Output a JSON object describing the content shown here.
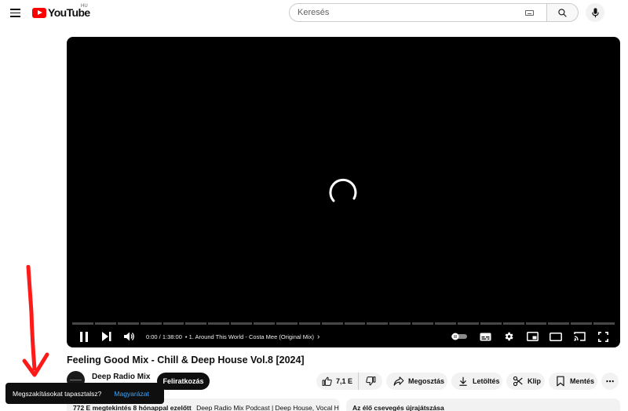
{
  "masthead": {
    "logo_text": "YouTube",
    "country_code": "HU",
    "search_placeholder": "Keresés"
  },
  "player": {
    "time": "0:00 / 1:38:00",
    "chapter": "• 1. Around This World - Costa Mee (Original Mix)",
    "chapter_chevron": "›"
  },
  "video": {
    "title": "Feeling Good Mix - Chill & Deep House Vol.8 [2024]",
    "channel_name": "Deep Radio Mix",
    "subscribe_label": "Feliratkozás"
  },
  "actions": {
    "like_count": "7,1 E",
    "share_label": "Megosztás",
    "download_label": "Letöltés",
    "clip_label": "Klip",
    "save_label": "Mentés",
    "more_label": "⋯"
  },
  "description": {
    "stats": "772 E megtekintés  8 hónappal ezelőtt",
    "snippet": "Deep Radio Mix Podcast | Deep House, Vocal H"
  },
  "chat": {
    "label": "Az élő csevegés újrajátszása"
  },
  "toast": {
    "message": "Megszakításokat tapasztalsz?",
    "link": "Magyarázat"
  },
  "colors": {
    "brand_red": "#ff0000",
    "link_blue": "#3ea6ff",
    "annotation_red": "#ff1a1a"
  }
}
